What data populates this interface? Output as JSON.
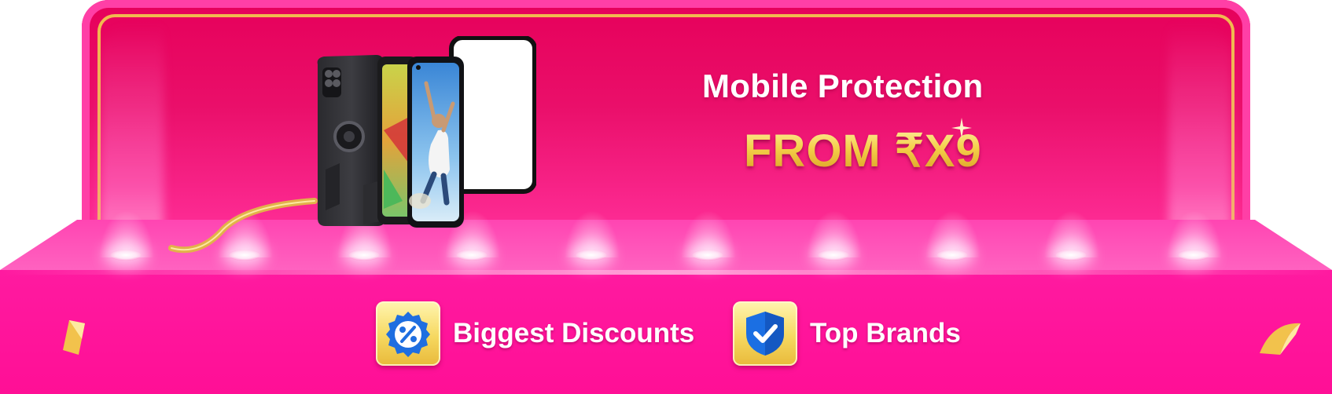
{
  "banner": {
    "title": "Mobile Protection",
    "price": "FROM ₹X9",
    "colors": {
      "panel": "#e6005a",
      "stage": "#ff1aa0",
      "gold": "#f4cf4a",
      "text": "#ffffff"
    }
  },
  "features": [
    {
      "label": "Biggest Discounts",
      "icon": "percent-badge-icon"
    },
    {
      "label": "Top Brands",
      "icon": "shield-check-icon"
    }
  ]
}
